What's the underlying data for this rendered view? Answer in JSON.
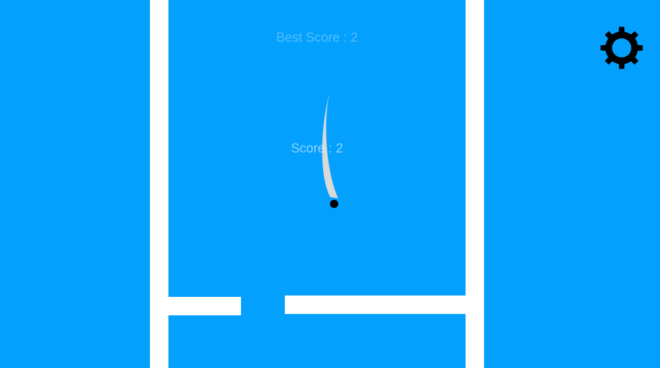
{
  "colors": {
    "background": "#03a0fe",
    "wall": "#ffffff",
    "platform": "#ffffff",
    "ball": "#000000",
    "trail": "#d9d9d9",
    "score_text": "#e6f4ff",
    "settings_icon": "#000000"
  },
  "hud": {
    "best_score": "Best Score : 2",
    "score": "Score : 2"
  },
  "icons": {
    "settings": "gear-icon"
  }
}
